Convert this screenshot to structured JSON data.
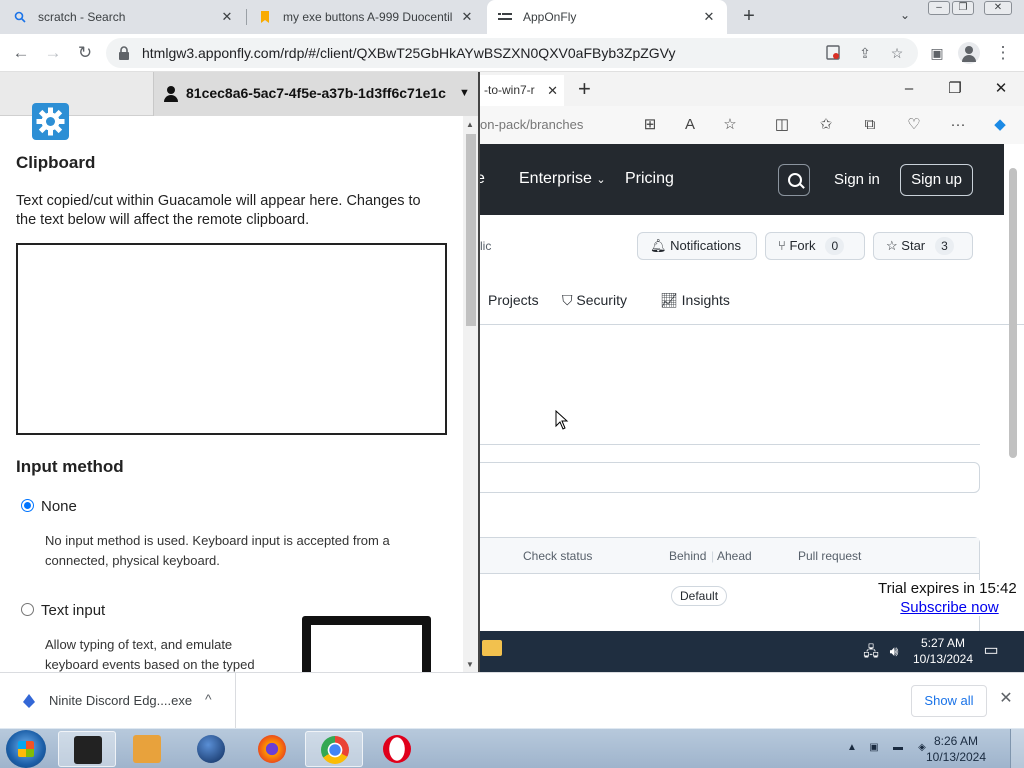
{
  "browser": {
    "tabs": [
      {
        "title": "scratch - Search",
        "icon": "search-icon"
      },
      {
        "title": "my exe buttons A-999 Duocentill",
        "icon": "bookmark-icon"
      },
      {
        "title": "AppOnFly",
        "icon": "apponfly-icon"
      }
    ],
    "url": "htmlgw3.apponfly.com/rdp/#/client/QXBwT25GbHkAYwBSZXN0QXV0aFByb3ZpZGVy"
  },
  "guacamole": {
    "username": "81cec8a6-5ac7-4f5e-a37b-1d3ff6c71e1c",
    "clipboard_title": "Clipboard",
    "clipboard_desc": "Text copied/cut within Guacamole will appear here. Changes to the text below will affect the remote clipboard.",
    "clipboard_value": "",
    "input_title": "Input method",
    "options": [
      {
        "label": "None",
        "selected": true,
        "desc": "No input method is used. Keyboard input is accepted from a connected, physical keyboard."
      },
      {
        "label": "Text input",
        "selected": false,
        "desc": "Allow typing of text, and emulate keyboard events based on the typed"
      }
    ]
  },
  "remote": {
    "edge_tab": "-to-win7-r",
    "edge_url": "on-pack/branches",
    "github": {
      "nav": [
        "Enterprise",
        "Pricing"
      ],
      "nav_partial": "e",
      "sign_in": "Sign in",
      "sign_up": "Sign up",
      "visibility_partial": "lic",
      "notifications": "Notifications",
      "fork": {
        "label": "Fork",
        "count": "0"
      },
      "star": {
        "label": "Star",
        "count": "3"
      },
      "tabs": [
        "Projects",
        "Security",
        "Insights"
      ],
      "columns": [
        "Check status",
        "Behind",
        "Ahead",
        "Pull request"
      ],
      "default_badge": "Default"
    },
    "trial_text": "Trial expires in 15:42",
    "subscribe": "Subscribe now",
    "time": "5:27 AM",
    "date": "10/13/2024"
  },
  "downloads": {
    "filename": "Ninite Discord Edg....exe",
    "show_all": "Show all"
  },
  "taskbar": {
    "time": "8:26 AM",
    "date": "10/13/2024"
  },
  "colors": {
    "guac_accent": "#2d8fd5",
    "github_header": "#24292f",
    "chrome_link": "#1a73e8"
  }
}
